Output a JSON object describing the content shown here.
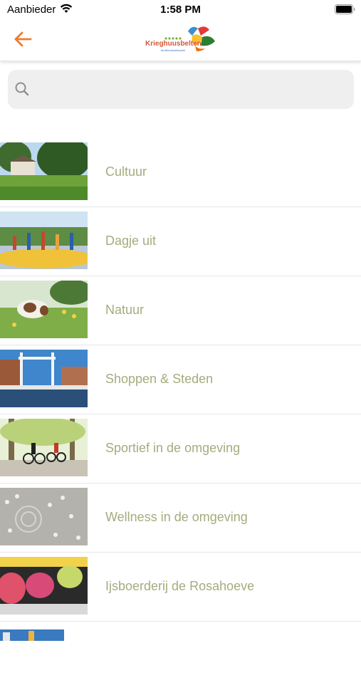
{
  "status_bar": {
    "carrier": "Aanbieder",
    "time": "1:58 PM",
    "icons": [
      "wifi-icon",
      "battery-icon"
    ]
  },
  "nav": {
    "back_icon": "arrow-left-icon",
    "accent_color": "#ef7b2f",
    "logo_text": "Krieghuusbelten",
    "logo_subtext": "familievakantiepark"
  },
  "search": {
    "value": "",
    "placeholder": "",
    "icon": "search-icon"
  },
  "list": {
    "label_color": "#a2ad7c",
    "items": [
      {
        "label": "Cultuur",
        "image": "park-with-house-photo"
      },
      {
        "label": "Dagje uit",
        "image": "group-on-trampoline-photo"
      },
      {
        "label": "Natuur",
        "image": "cow-in-meadow-photo"
      },
      {
        "label": "Shoppen & Steden",
        "image": "drawbridge-canal-photo"
      },
      {
        "label": "Sportief in de omgeving",
        "image": "cyclists-in-forest-photo"
      },
      {
        "label": "Wellness in de omgeving",
        "image": "spa-stones-photo"
      },
      {
        "label": "Ijsboerderij de Rosahoeve",
        "image": "ice-cream-display-photo"
      }
    ]
  }
}
